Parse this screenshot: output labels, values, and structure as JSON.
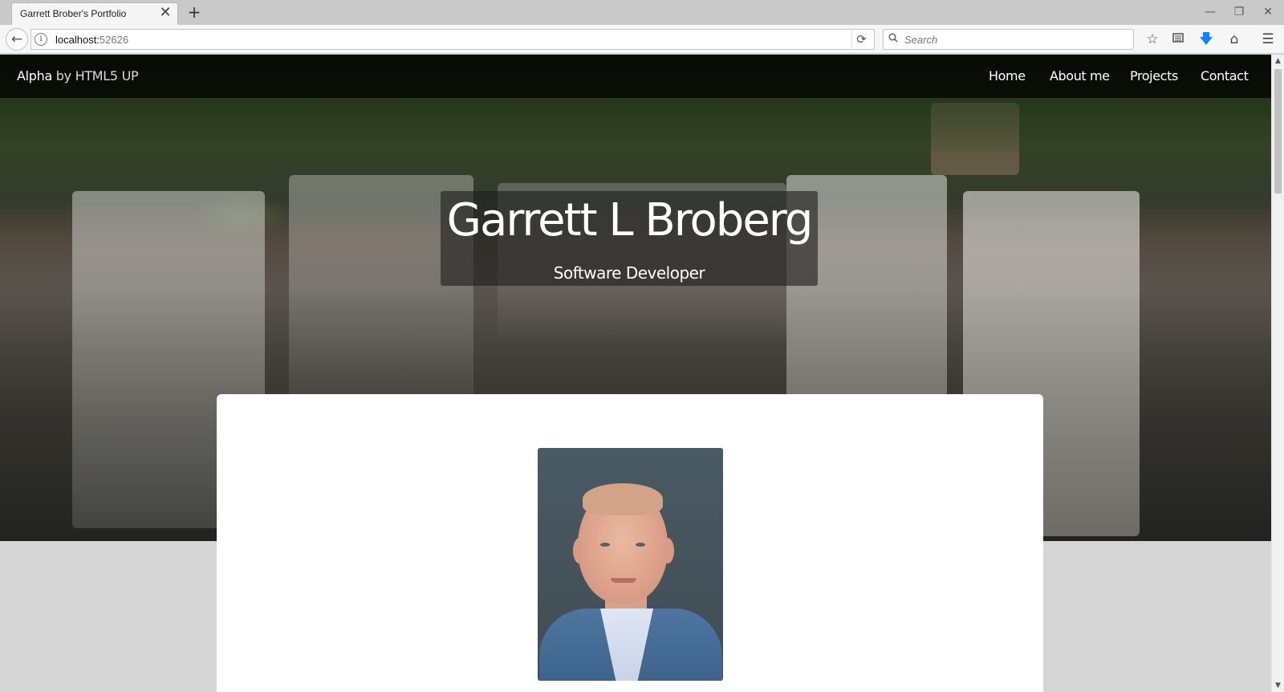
{
  "browser": {
    "tab_title": "Garrett Brober's Portfolio",
    "tab_close": "✕",
    "new_tab": "+",
    "url_host": "localhost:",
    "url_port": "52626",
    "search_placeholder": "Search",
    "window_controls": {
      "minimize": "—",
      "restore": "❐",
      "close": "✕"
    },
    "toolbar_icons": [
      "star-icon",
      "reader-icon",
      "download-icon",
      "home-icon",
      "menu-icon"
    ]
  },
  "site": {
    "brand_bold": "Alpha",
    "brand_light": " by HTML5 UP",
    "nav": [
      "Home",
      "About me",
      "Projects",
      "Contact"
    ],
    "title": "Garrett L Broberg",
    "subtitle": "Software Developer"
  },
  "colors": {
    "header_bg": "rgba(0,0,0,0.75)",
    "card_bg": "#ffffff",
    "page_bg": "#d6d6d6",
    "download_accent": "#0a84ff"
  }
}
